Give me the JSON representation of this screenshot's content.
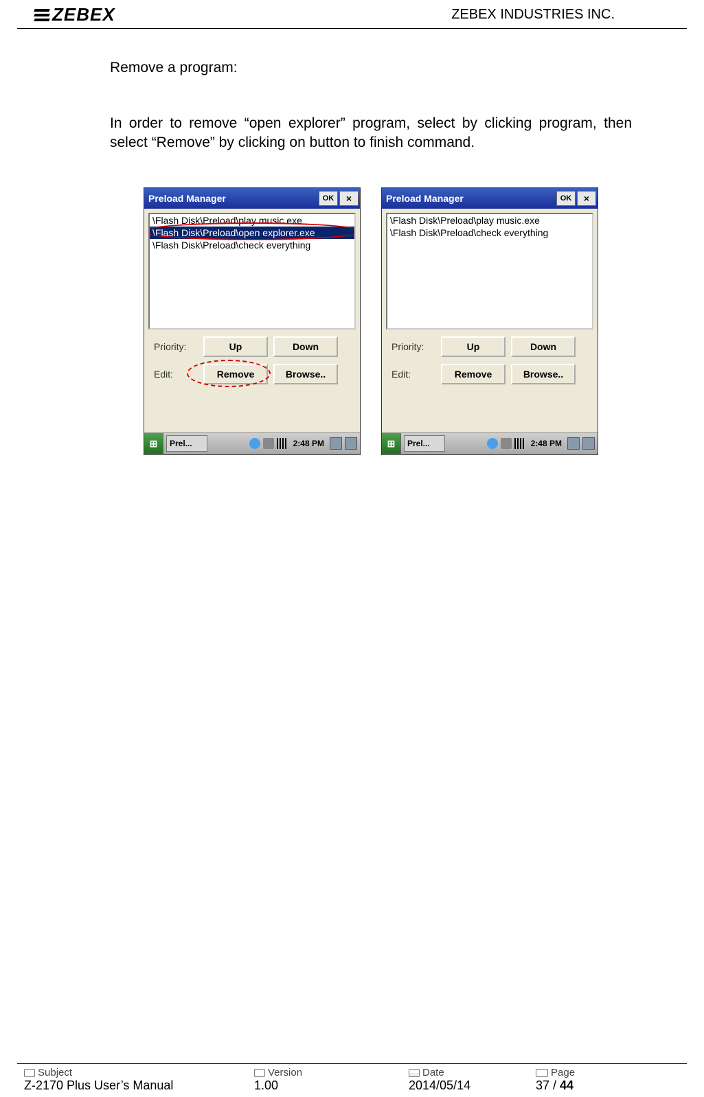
{
  "header": {
    "logo_text": "ZEBEX",
    "company": "ZEBEX INDUSTRIES INC."
  },
  "section_title": "Remove a program:",
  "body_text": "In order to remove “open explorer” program, select by clicking program, then select “Remove” by clicking on button to finish command.",
  "screens": [
    {
      "title": "Preload Manager",
      "ok": "OK",
      "close": "×",
      "items": [
        {
          "text": "\\Flash Disk\\Preload\\play music.exe",
          "selected": false
        },
        {
          "text": "\\Flash Disk\\Preload\\open explorer.exe",
          "selected": true
        },
        {
          "text": "\\Flash Disk\\Preload\\check everything",
          "selected": false
        }
      ],
      "priority_label": "Priority:",
      "edit_label": "Edit:",
      "up": "Up",
      "down": "Down",
      "remove": "Remove",
      "browse": "Browse..",
      "task_label": "Prel...",
      "clock": "2:48 PM",
      "highlight_list_item": true,
      "highlight_remove": true
    },
    {
      "title": "Preload Manager",
      "ok": "OK",
      "close": "×",
      "items": [
        {
          "text": "\\Flash Disk\\Preload\\play music.exe",
          "selected": false
        },
        {
          "text": "\\Flash Disk\\Preload\\check everything",
          "selected": false
        }
      ],
      "priority_label": "Priority:",
      "edit_label": "Edit:",
      "up": "Up",
      "down": "Down",
      "remove": "Remove",
      "browse": "Browse..",
      "task_label": "Prel...",
      "clock": "2:48 PM",
      "highlight_list_item": false,
      "highlight_remove": false
    }
  ],
  "footer": {
    "subject_label": "Subject",
    "subject_value": "Z-2170 Plus User’s Manual",
    "version_label": "Version",
    "version_value": "1.00",
    "date_label": "Date",
    "date_value": "2014/05/14",
    "page_label": "Page",
    "page_current": "37",
    "page_sep": " / ",
    "page_total": "44"
  }
}
